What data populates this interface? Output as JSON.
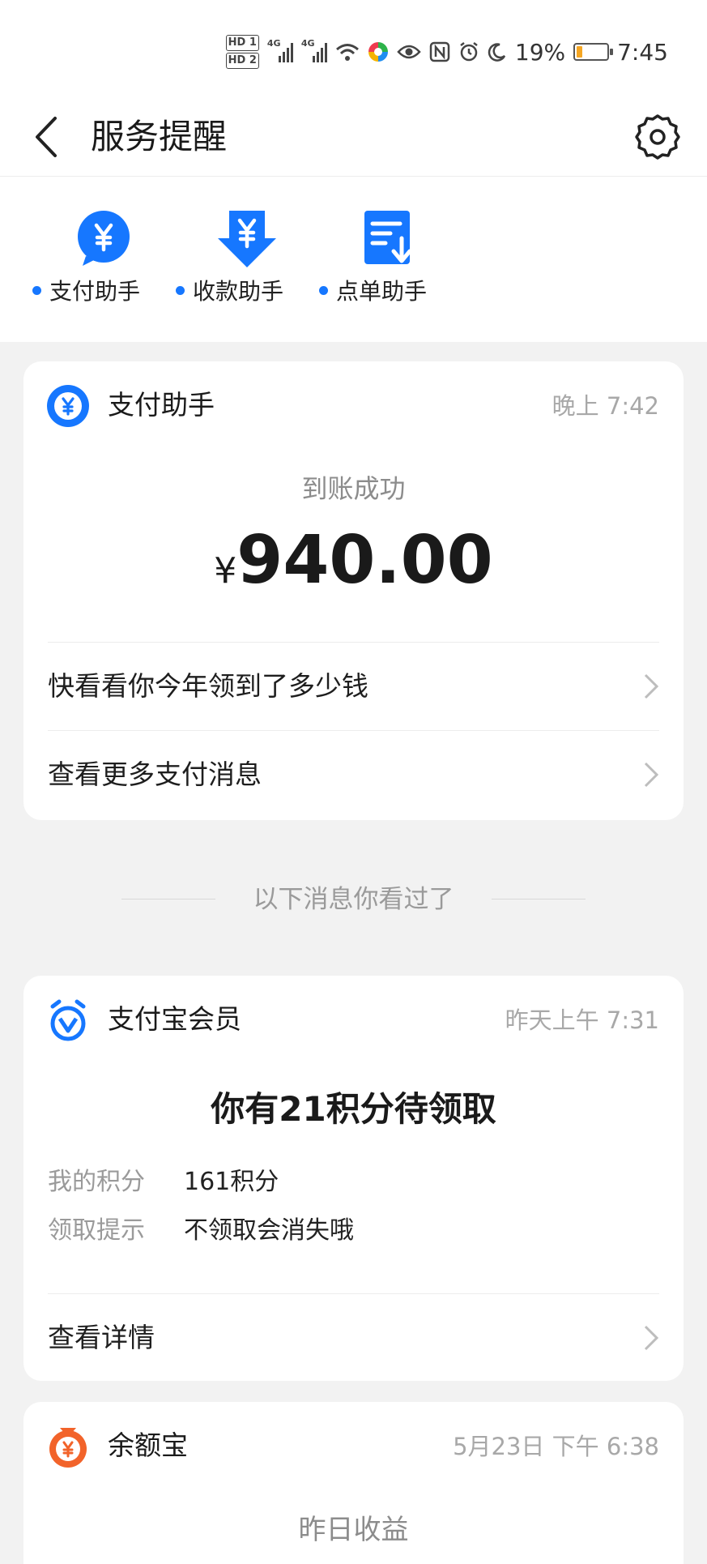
{
  "status_bar": {
    "hd1": "HD 1",
    "hd2": "HD 2",
    "net1": "4G",
    "net2": "4G",
    "battery_percent": "19%",
    "battery_level": 0.19,
    "time": "7:45",
    "icons": [
      "wifi-icon",
      "color-wheel-icon",
      "eye-icon",
      "nfc-icon",
      "alarm-icon",
      "moon-icon",
      "battery-icon"
    ]
  },
  "header": {
    "title": "服务提醒",
    "back_icon": "chevron-left-icon",
    "settings_icon": "gear-icon"
  },
  "assistants": [
    {
      "label": "支付助手",
      "icon": "yuan-bubble-icon"
    },
    {
      "label": "收款助手",
      "icon": "yuan-download-icon"
    },
    {
      "label": "点单助手",
      "icon": "order-list-icon"
    }
  ],
  "card_payment": {
    "name": "支付助手",
    "time": "晚上 7:42",
    "status": "到账成功",
    "currency": "¥",
    "amount": "940.00",
    "links": [
      "快看看你今年领到了多少钱",
      "查看更多支付消息"
    ]
  },
  "seen_divider": "以下消息你看过了",
  "card_member": {
    "name": "支付宝会员",
    "time": "昨天上午 7:31",
    "headline": "你有21积分待领取",
    "rows": [
      {
        "key": "我的积分",
        "value": "161积分"
      },
      {
        "key": "领取提示",
        "value": "不领取会消失哦"
      }
    ],
    "link": "查看详情"
  },
  "card_yuebao": {
    "name": "余额宝",
    "time": "5月23日 下午 6:38",
    "subtitle": "昨日收益"
  },
  "colors": {
    "accent": "#1677ff",
    "orange": "#f2632a",
    "background": "#f2f2f2"
  }
}
